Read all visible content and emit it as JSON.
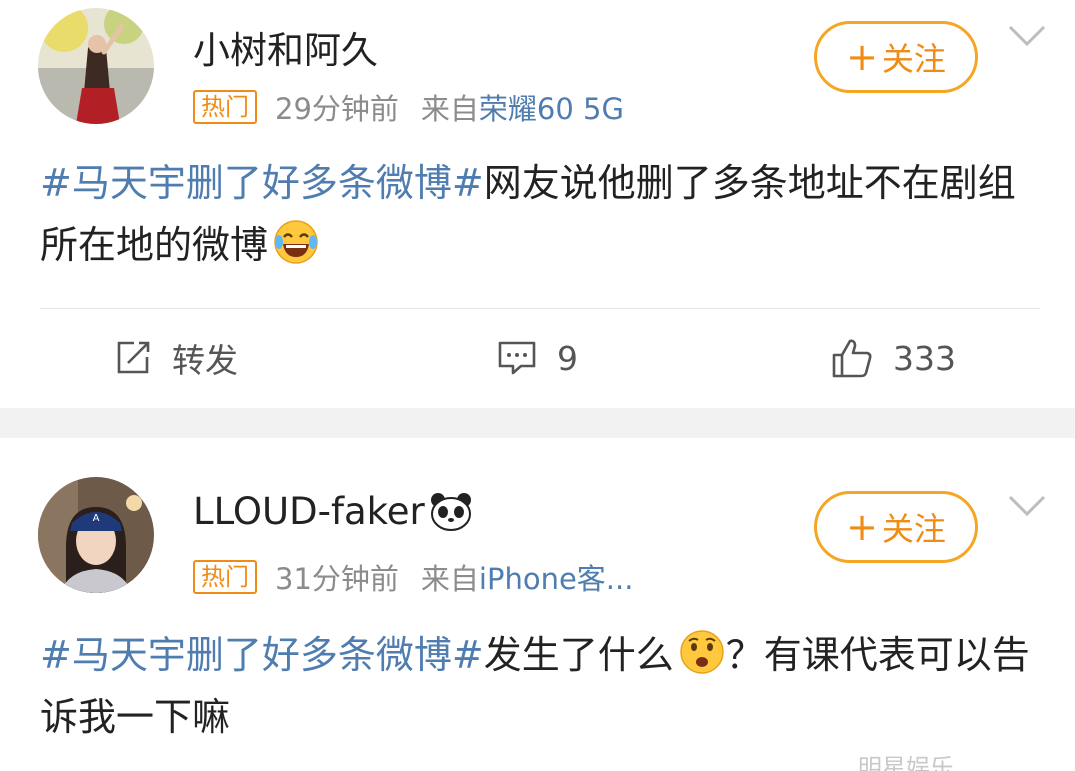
{
  "posts": [
    {
      "username": "小树和阿久",
      "badge": "热门",
      "time": "29分钟前",
      "source_prefix": "来自",
      "source_device": "荣耀60 5G",
      "follow_label": "关注",
      "topic": "#马天宇删了好多条微博#",
      "text": "网友说他删了多条地址不在剧组所在地的微博",
      "emoji": "laughing-tears-emoji",
      "actions": {
        "repost_label": "转发",
        "comment_count": "9",
        "like_count": "333"
      }
    },
    {
      "username": "LLOUD-faker",
      "username_emoji": "panda-emoji",
      "badge": "热门",
      "time": "31分钟前",
      "source_prefix": "来自",
      "source_device": "iPhone客...",
      "follow_label": "关注",
      "topic": "#马天宇删了好多条微博#",
      "text_before_emoji": "发生了什么",
      "emoji": "surprised-face-emoji",
      "text_after_emoji": "？有课代表可以告诉我一下嘛"
    }
  ],
  "watermark": "明星娱乐",
  "colors": {
    "accent_orange": "#f08b16",
    "link_blue": "#507daf",
    "meta_gray": "#8c8c8c",
    "separator_gray": "#f2f2f2"
  }
}
